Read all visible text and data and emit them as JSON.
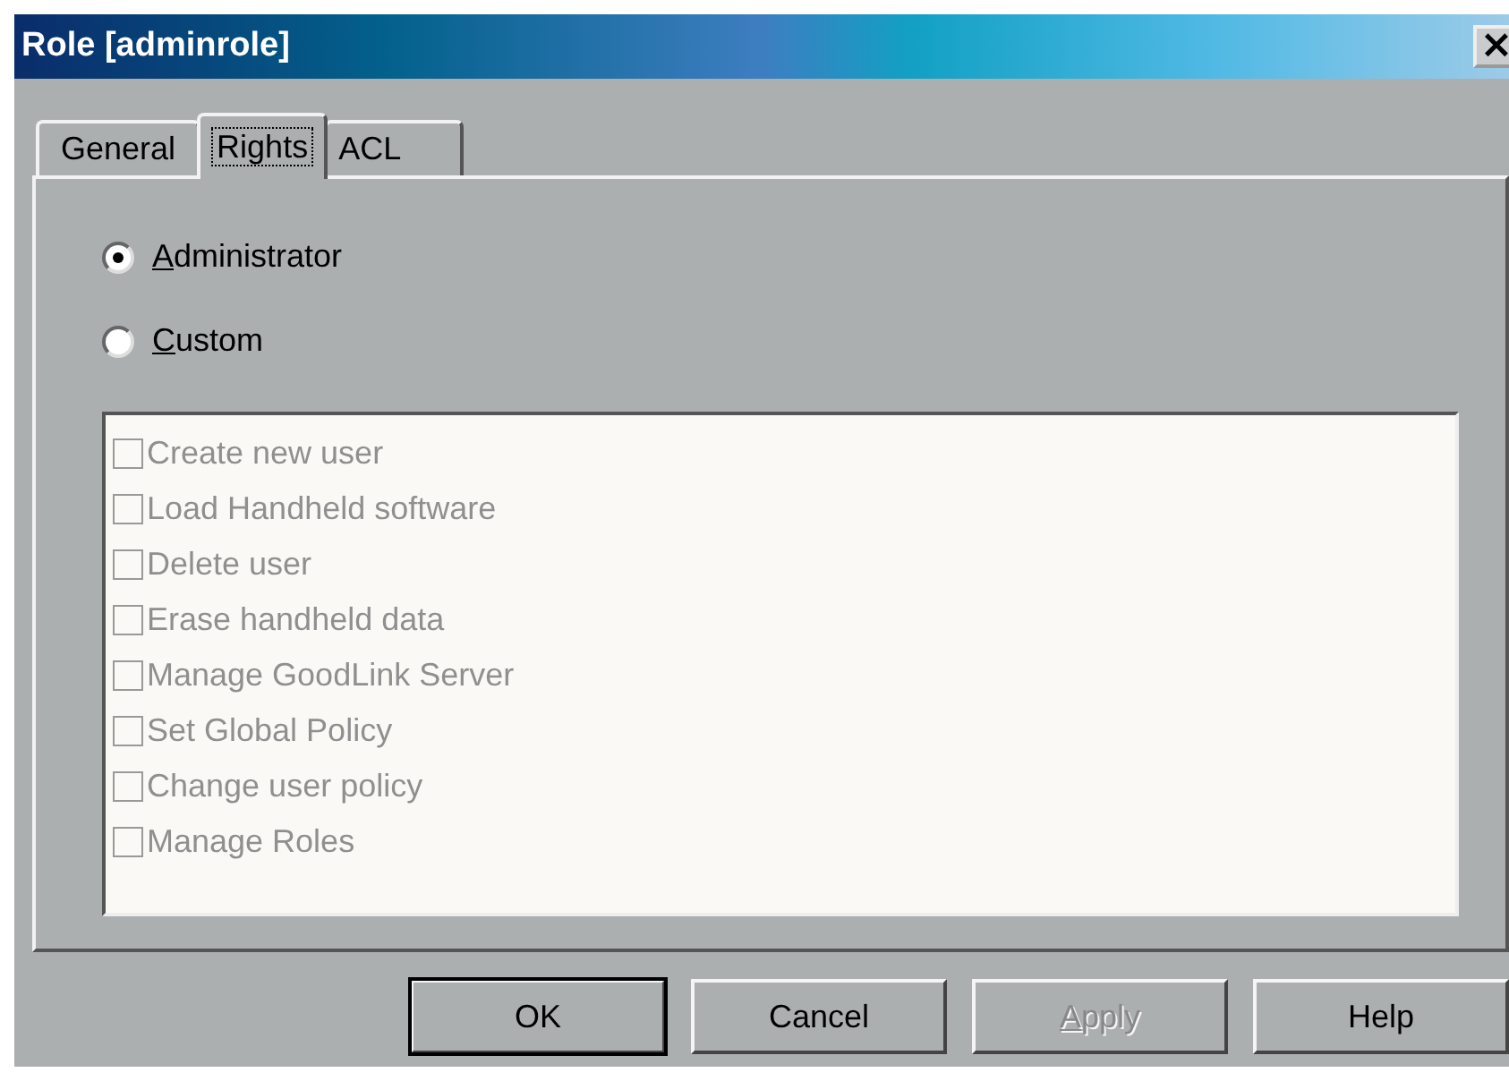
{
  "window": {
    "title": "Role [adminrole]"
  },
  "close_button": {
    "label": "×"
  },
  "tabs": [
    {
      "label": "General",
      "selected": false
    },
    {
      "label": "Rights",
      "selected": true
    },
    {
      "label": "ACL",
      "selected": false
    }
  ],
  "radios": [
    {
      "label": "Administrator",
      "selected": true,
      "mnemonic": true
    },
    {
      "label": "Custom",
      "selected": false,
      "mnemonic": true
    }
  ],
  "rights": [
    {
      "label": "Create new user",
      "checked": false,
      "disabled": true
    },
    {
      "label": "Load Handheld software",
      "checked": false,
      "disabled": true
    },
    {
      "label": "Delete user",
      "checked": false,
      "disabled": true
    },
    {
      "label": "Erase handheld data",
      "checked": false,
      "disabled": true
    },
    {
      "label": "Manage GoodLink Server",
      "checked": false,
      "disabled": true
    },
    {
      "label": "Set Global Policy",
      "checked": false,
      "disabled": true
    },
    {
      "label": "Change user policy",
      "checked": false,
      "disabled": true
    },
    {
      "label": "Manage Roles",
      "checked": false,
      "disabled": true
    }
  ],
  "buttons": [
    {
      "label": "OK",
      "default": true,
      "disabled": false,
      "mnemonic": false
    },
    {
      "label": "Cancel",
      "default": false,
      "disabled": false,
      "mnemonic": false
    },
    {
      "label": "Apply",
      "default": false,
      "disabled": true,
      "mnemonic": true
    },
    {
      "label": "Help",
      "default": false,
      "disabled": false,
      "mnemonic": false
    }
  ]
}
